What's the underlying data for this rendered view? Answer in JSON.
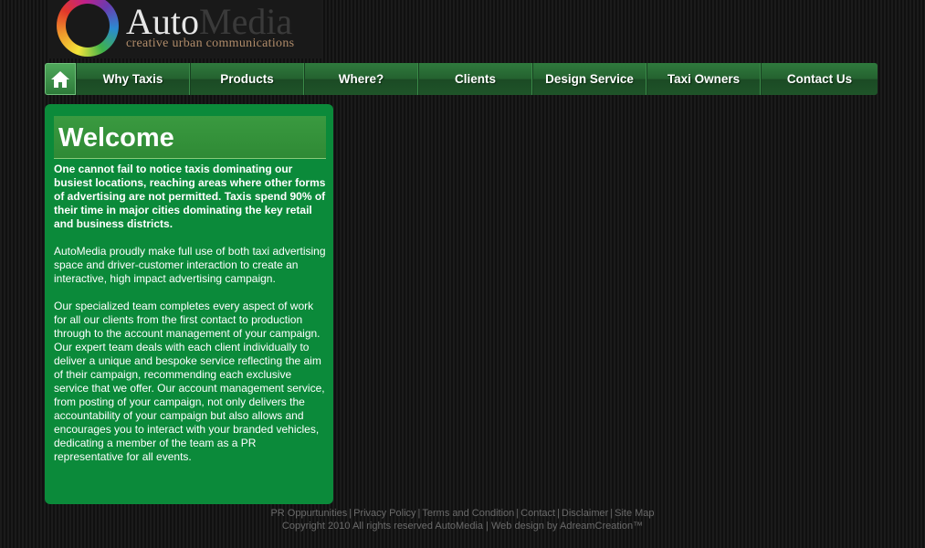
{
  "logo": {
    "name_part1": "Auto",
    "name_part2": "Media",
    "tagline": "creative urban communications"
  },
  "nav": {
    "home_icon": "home-icon",
    "items": [
      "Why Taxis",
      "Products",
      "Where?",
      "Clients",
      "Design Service",
      "Taxi Owners",
      "Contact Us"
    ]
  },
  "content": {
    "heading": "Welcome",
    "paragraphs": [
      "One cannot fail to notice taxis dominating our busiest locations, reaching areas where other forms of advertising are not permitted. Taxis spend 90% of their time in major cities dominating the key retail and business districts.",
      "AutoMedia proudly make full use of both taxi advertising space and driver-customer interaction to create an interactive, high impact advertising campaign.",
      "Our specialized team completes every aspect of work for all our clients from the first contact to production through to the account management of your campaign. Our expert team deals with each client individually to deliver a unique and bespoke service reflecting the aim of their campaign, recommending each exclusive service that we offer. Our account management service, from posting of your campaign, not only delivers the accountability of your campaign but also allows and encourages you to interact with your branded vehicles, dedicating a member of the team as a PR representative for all events."
    ]
  },
  "footer": {
    "links": [
      "PR Oppurtunities",
      "Privacy Policy",
      "Terms and Condition",
      "Contact",
      "Disclaimer",
      "Site Map"
    ],
    "copyright": "Copyright 2010 All rights reserved AutoMedia | Web design by AdreamCreation™"
  },
  "colors": {
    "panel_green": "#0b8a3a",
    "nav_green": "#24612f",
    "background": "#141414"
  }
}
